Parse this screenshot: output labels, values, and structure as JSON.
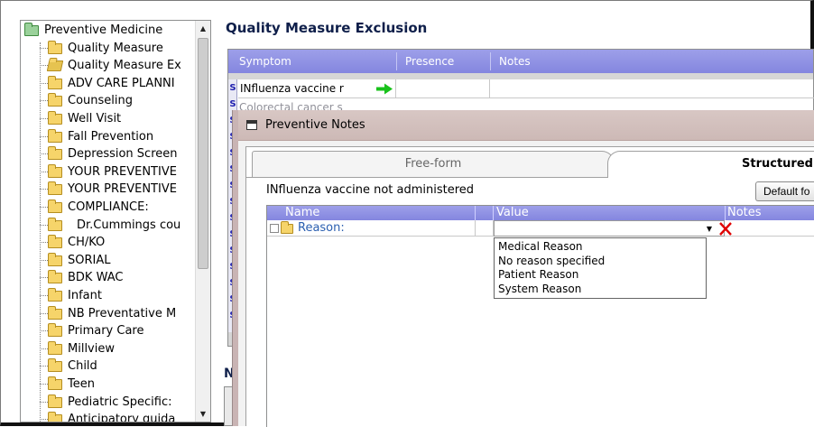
{
  "tree": {
    "items": [
      {
        "label": "Preventive Medicine",
        "kind": "root"
      },
      {
        "label": "Quality Measure",
        "kind": "closed"
      },
      {
        "label": "Quality Measure Ex",
        "kind": "open"
      },
      {
        "label": "ADV CARE PLANNI",
        "kind": "closed"
      },
      {
        "label": "Counseling",
        "kind": "closed"
      },
      {
        "label": "Well Visit",
        "kind": "closed"
      },
      {
        "label": "Fall Prevention",
        "kind": "closed"
      },
      {
        "label": "Depression Screen",
        "kind": "closed"
      },
      {
        "label": "YOUR PREVENTIVE",
        "kind": "closed"
      },
      {
        "label": "YOUR PREVENTIVE",
        "kind": "closed"
      },
      {
        "label": "COMPLIANCE:",
        "kind": "closed"
      },
      {
        "label": "Dr.Cummings cou",
        "kind": "closed"
      },
      {
        "label": "CH/KO",
        "kind": "closed"
      },
      {
        "label": "SORIAL",
        "kind": "closed"
      },
      {
        "label": "BDK WAC",
        "kind": "closed"
      },
      {
        "label": "Infant",
        "kind": "closed"
      },
      {
        "label": "NB Preventative M",
        "kind": "closed"
      },
      {
        "label": "Primary Care",
        "kind": "closed"
      },
      {
        "label": "Millview",
        "kind": "closed"
      },
      {
        "label": "Child",
        "kind": "closed"
      },
      {
        "label": "Teen",
        "kind": "closed"
      },
      {
        "label": "Pediatric Specific:",
        "kind": "closed"
      },
      {
        "label": "Anticipatory guida",
        "kind": "closed"
      }
    ]
  },
  "main": {
    "title": "Quality Measure Exclusion",
    "grid_headers": {
      "symptom": "Symptom",
      "presence": "Presence",
      "notes": "Notes"
    },
    "row_marker": "S",
    "rows": [
      {
        "name": "INfluenza vaccine r"
      },
      {
        "name": "Colorectal cancer s"
      }
    ],
    "notes_label": "N"
  },
  "dialog": {
    "title": "Preventive Notes",
    "tabs": {
      "freeform": "Free-form",
      "structured": "Structured"
    },
    "item_title": "INfluenza vaccine not administered",
    "default_button": "Default fo",
    "grid_headers": {
      "name": "Name",
      "value": "Value",
      "notes": "Notes"
    },
    "row": {
      "name": "Reason:"
    },
    "dropdown_options": [
      "Medical Reason",
      "No reason specified",
      "Patient Reason",
      "System Reason"
    ]
  },
  "colors": {
    "grid_header": "#8c8ee3",
    "folder": "#f6d46a",
    "delete_x": "#e00000",
    "arrow": "#19c21b"
  }
}
